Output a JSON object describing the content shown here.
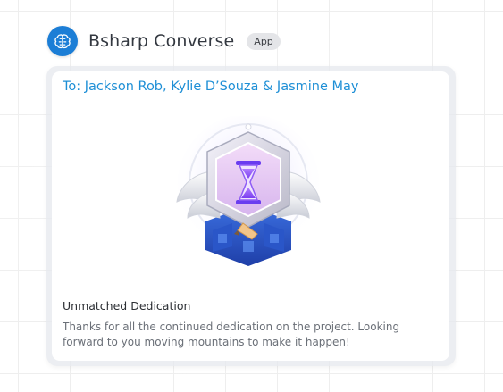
{
  "app": {
    "name": "Bsharp Converse",
    "badge": "App",
    "icon": "brain-icon",
    "accent": "#1c7ed6"
  },
  "message_card": {
    "recipients": "To: Jackson Rob, Kylie D’Souza & Jasmine May",
    "badge_icon": "hourglass-trophy-badge",
    "title": "Unmatched Dedication",
    "body": "Thanks for all the continued dedication on the project. Looking forward to you moving mountains to make it happen!",
    "recipient_color": "#1e8fd6"
  }
}
